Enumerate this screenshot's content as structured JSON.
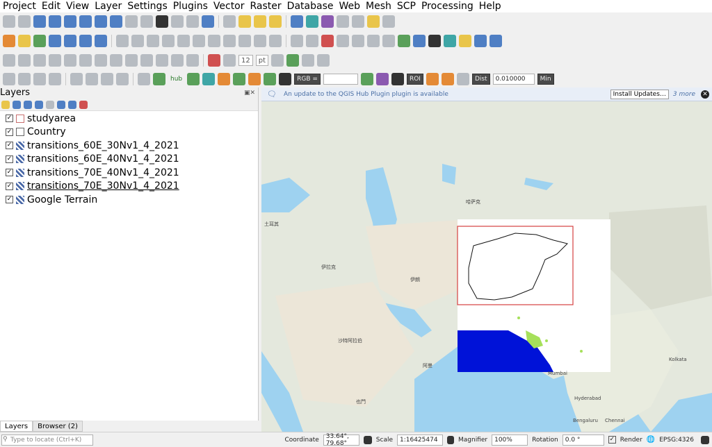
{
  "menu": [
    "Project",
    "Edit",
    "View",
    "Layer",
    "Settings",
    "Plugins",
    "Vector",
    "Raster",
    "Database",
    "Web",
    "Mesh",
    "SCP",
    "Processing",
    "Help"
  ],
  "toolbar": {
    "hub_label": "hub",
    "font_size_value": "12",
    "font_unit": "pt",
    "rgb_label": "RGB =",
    "roi_label": "ROI",
    "dist_label": "Dist",
    "dist_value": "0.010000",
    "min_label": "Min"
  },
  "panel": {
    "title": "Layers",
    "layers": [
      {
        "name": "studyarea",
        "checked": true,
        "kind": "vector"
      },
      {
        "name": "Country",
        "checked": true,
        "kind": "vector"
      },
      {
        "name": "transitions_60E_30Nv1_4_2021",
        "checked": true,
        "kind": "raster"
      },
      {
        "name": "transitions_60E_40Nv1_4_2021",
        "checked": true,
        "kind": "raster"
      },
      {
        "name": "transitions_70E_40Nv1_4_2021",
        "checked": true,
        "kind": "raster"
      },
      {
        "name": "transitions_70E_30Nv1_4_2021",
        "checked": true,
        "kind": "raster"
      },
      {
        "name": "Google Terrain",
        "checked": true,
        "kind": "raster"
      }
    ],
    "tabs": [
      "Layers",
      "Browser (2)"
    ]
  },
  "message": {
    "text": "An update to the QGIS Hub Plugin plugin is available",
    "button": "Install Updates…",
    "more": "3 more"
  },
  "map_labels": [
    {
      "text": "土耳其",
      "x": 0,
      "y": 0
    },
    {
      "text": "伊拉克",
      "x": 0,
      "y": 0
    },
    {
      "text": "沙特阿拉伯",
      "x": 0,
      "y": 0
    },
    {
      "text": "伊朗",
      "x": 0,
      "y": 0
    },
    {
      "text": "阿曼",
      "x": 0,
      "y": 0
    },
    {
      "text": "也門",
      "x": 0,
      "y": 0
    },
    {
      "text": "哈萨克",
      "x": 0,
      "y": 0
    },
    {
      "text": "Mumbai",
      "x": 0,
      "y": 0
    },
    {
      "text": "Hyderabad",
      "x": 0,
      "y": 0
    },
    {
      "text": "Bengaluru",
      "x": 0,
      "y": 0
    },
    {
      "text": "Chennai",
      "x": 0,
      "y": 0
    },
    {
      "text": "Kolkata",
      "x": 0,
      "y": 0
    }
  ],
  "status": {
    "locate_placeholder": "Type to locate (Ctrl+K)",
    "coordinate_label": "Coordinate",
    "coordinate_value": "33.64°, 79.68°",
    "scale_label": "Scale",
    "scale_value": "1:16425474",
    "magnifier_label": "Magnifier",
    "magnifier_value": "100%",
    "rotation_label": "Rotation",
    "rotation_value": "0.0 °",
    "render_label": "Render",
    "crs": "EPSG:4326"
  }
}
